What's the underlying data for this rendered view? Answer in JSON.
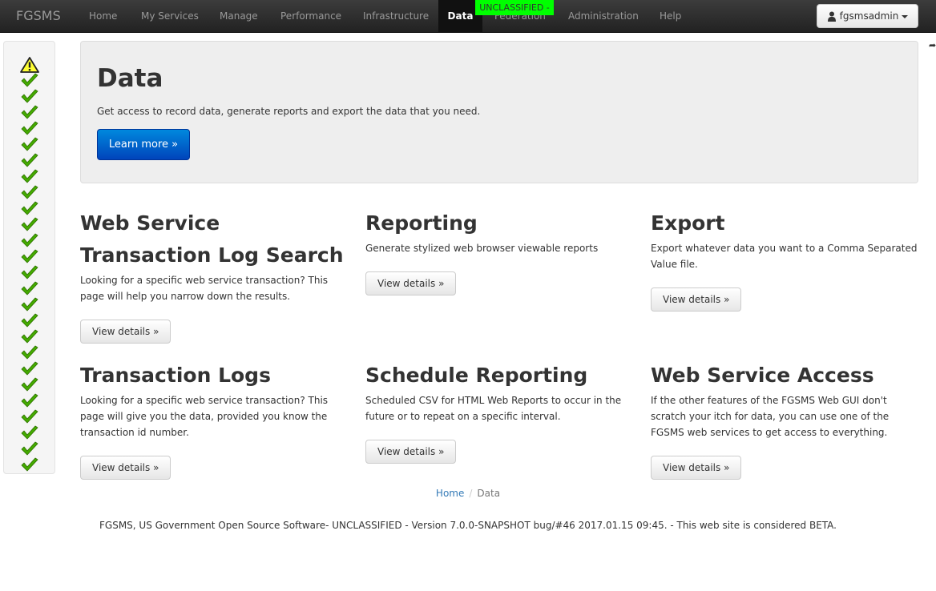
{
  "navbar": {
    "brand": "FGSMS",
    "items": [
      {
        "label": "Home",
        "active": false
      },
      {
        "label": "My Services",
        "active": false
      },
      {
        "label": "Manage",
        "active": false
      },
      {
        "label": "Performance",
        "active": false
      },
      {
        "label": "Infrastructure",
        "active": false
      },
      {
        "label": "Data",
        "active": true
      },
      {
        "label": "Federation",
        "active": false
      },
      {
        "label": "Administration",
        "active": false
      },
      {
        "label": "Help",
        "active": false
      }
    ],
    "classification_banner": "UNCLASSIFIED -",
    "user_menu_label": "fgsmsadmin"
  },
  "status_sidebar": {
    "icons": [
      "warning-icon",
      "check-icon",
      "check-icon",
      "check-icon",
      "check-icon",
      "check-icon",
      "check-icon",
      "check-icon",
      "check-icon",
      "check-icon",
      "check-icon",
      "check-icon",
      "check-icon",
      "check-icon",
      "check-icon",
      "check-icon",
      "check-icon",
      "check-icon",
      "check-icon",
      "check-icon",
      "check-icon",
      "check-icon",
      "check-icon",
      "check-icon",
      "check-icon",
      "check-icon"
    ]
  },
  "jumbotron": {
    "title": "Data",
    "text": "Get access to record data, generate reports and export the data that you need.",
    "button_label": "Learn more »"
  },
  "features": [
    {
      "title": "Web Service Transaction Log Search",
      "text": "Looking for a specific web service transaction? This page will help you narrow down the results.",
      "button_label": "View details »"
    },
    {
      "title": "Reporting",
      "text": "Generate stylized web browser viewable reports",
      "button_label": "View details »"
    },
    {
      "title": "Export",
      "text": "Export whatever data you want to a Comma Separated Value file.",
      "button_label": "View details »"
    },
    {
      "title": "Transaction Logs",
      "text": "Looking for a specific web service transaction? This page will give you the data, provided you know the transaction id number.",
      "button_label": "View details »"
    },
    {
      "title": "Schedule Reporting",
      "text": "Scheduled CSV for HTML Web Reports to occur in the future or to repeat on a specific interval.",
      "button_label": "View details »"
    },
    {
      "title": "Web Service Access",
      "text": "If the other features of the FGSMS Web GUI don't scratch your itch for data, you can use one of the FGSMS web services to get access to everything.",
      "button_label": "View details »"
    }
  ],
  "breadcrumb": {
    "home": "Home",
    "separator": "/",
    "current": "Data"
  },
  "footer": {
    "text": "FGSMS, US Government Open Source Software- UNCLASSIFIED - Version 7.0.0-SNAPSHOT bug/#46 2017.01.15 09:45. - This web site is considered BETA."
  },
  "colors": {
    "classification_banner": "#00ff00",
    "primary_button": "#0055cc",
    "check": "#44aa00",
    "warning": "#ffff00"
  }
}
